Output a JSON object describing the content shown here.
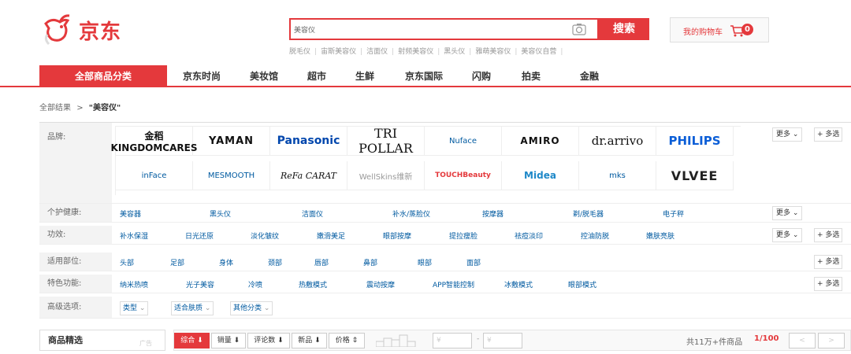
{
  "logo": {
    "text": "京东"
  },
  "search": {
    "value": "美容仪",
    "button": "搜索"
  },
  "hotwords": [
    "脱毛仪",
    "宙斯美容仪",
    "洁面仪",
    "射频美容仪",
    "黑头仪",
    "雅萌美容仪",
    "美容仪自营"
  ],
  "cart": {
    "label": "我的购物车",
    "count": "0"
  },
  "nav": {
    "all_categories": "全部商品分类",
    "items": [
      "京东时尚",
      "美妆馆",
      "超市",
      "生鲜",
      "京东国际",
      "闪购",
      "拍卖",
      "金融"
    ]
  },
  "breadcrumb": {
    "root": "全部结果",
    "sep": ">",
    "keyword": "\"美容仪\""
  },
  "filters": {
    "brand": {
      "label": "品牌:",
      "row1": [
        "金稻 KINGDOMCARES",
        "YAMAN",
        "Panasonic",
        "TRI POLLAR",
        "Nuface",
        "AMIRO",
        "dr.arrivo",
        "PHILIPS"
      ],
      "row2": [
        "inFace",
        "MESMOOTH",
        "ReFa CARAT",
        "WellSkins维新",
        "TOUCHBeauty",
        "Midea",
        "mks",
        "VLVEE"
      ],
      "more": "更多",
      "multi": "+ 多选"
    },
    "personal_care": {
      "label": "个护健康:",
      "values": [
        "美容器",
        "黑头仪",
        "洁面仪",
        "补水/蒸脸仪",
        "按摩器",
        "剃/脱毛器",
        "电子秤"
      ],
      "more": "更多"
    },
    "effect": {
      "label": "功效:",
      "values": [
        "补水保湿",
        "日光还原",
        "淡化皱纹",
        "嫩滑美足",
        "眼部按摩",
        "提拉瘦脸",
        "祛痘淡印",
        "控油防脱",
        "嫩肤亮肤"
      ],
      "more": "更多",
      "multi": "+ 多选"
    },
    "body_part": {
      "label": "适用部位:",
      "values": [
        "头部",
        "足部",
        "身体",
        "颈部",
        "唇部",
        "鼻部",
        "眼部",
        "面部"
      ],
      "multi": "+ 多选"
    },
    "special": {
      "label": "特色功能:",
      "values": [
        "纳米热喷",
        "光子美容",
        "冷喷",
        "热敷模式",
        "震动按摩",
        "APP智能控制",
        "冰敷模式",
        "眼部模式"
      ],
      "multi": "+ 多选"
    },
    "advanced": {
      "label": "高级选项:",
      "values": [
        "类型",
        "适合肤质",
        "其他分类"
      ]
    }
  },
  "sortbar": {
    "goods_select": "商品精选",
    "ad": "广告",
    "sorts": [
      "综合 ⬇",
      "销量 ⬇",
      "评论数 ⬇",
      "新品 ⬇",
      "价格 ⇕"
    ],
    "price_from_placeholder": "¥",
    "price_to_placeholder": "¥",
    "dash": "-",
    "total": "共11万+件商品",
    "page": "1/100",
    "prev": "<",
    "next": ">"
  }
}
